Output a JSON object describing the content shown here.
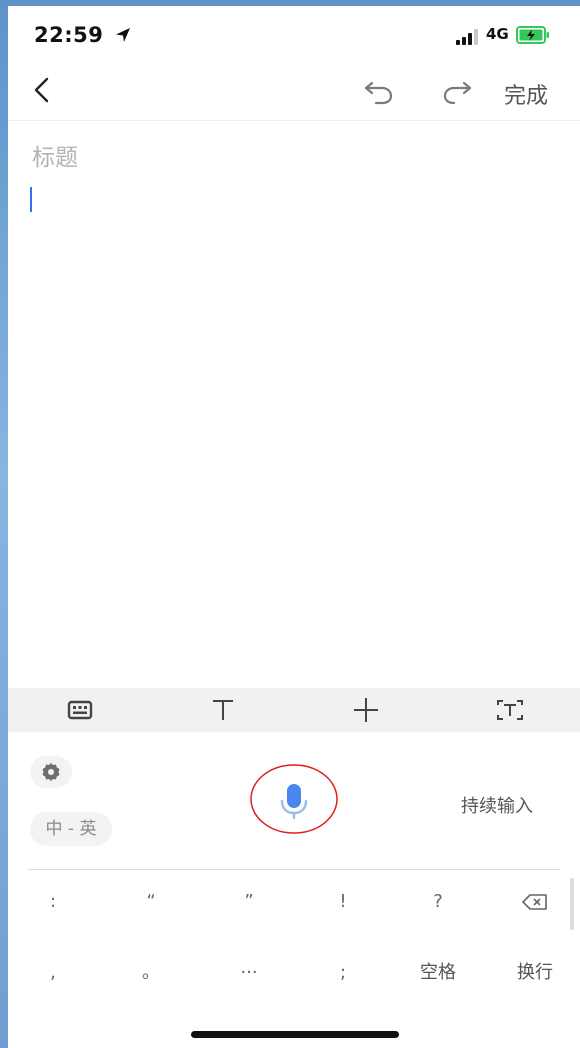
{
  "status_bar": {
    "time": "22:59",
    "network": "4G",
    "battery_color": "#34c759"
  },
  "nav": {
    "back_icon": "chevron-left-icon",
    "undo_icon": "undo-icon",
    "redo_icon": "redo-icon",
    "done_label": "完成"
  },
  "editor": {
    "title_placeholder": "标题",
    "caret_color": "#3a6df0"
  },
  "format_toolbar": {
    "items": [
      {
        "name": "keyboard-icon"
      },
      {
        "name": "text-format-icon"
      },
      {
        "name": "insert-icon"
      },
      {
        "name": "text-recognition-icon"
      }
    ]
  },
  "voice_panel": {
    "settings_icon": "gear-icon",
    "language_label": "中 - 英",
    "mic_icon": "microphone-icon",
    "mic_color": "#4a86f0",
    "highlight_color": "#e02020",
    "continuous_label": "持续输入"
  },
  "punctuation": {
    "row1": [
      ":",
      "“",
      "”",
      "!",
      "?"
    ],
    "row2": [
      ",",
      "。",
      "···",
      ";",
      "空格",
      "换行"
    ],
    "delete_icon": "delete-icon"
  }
}
